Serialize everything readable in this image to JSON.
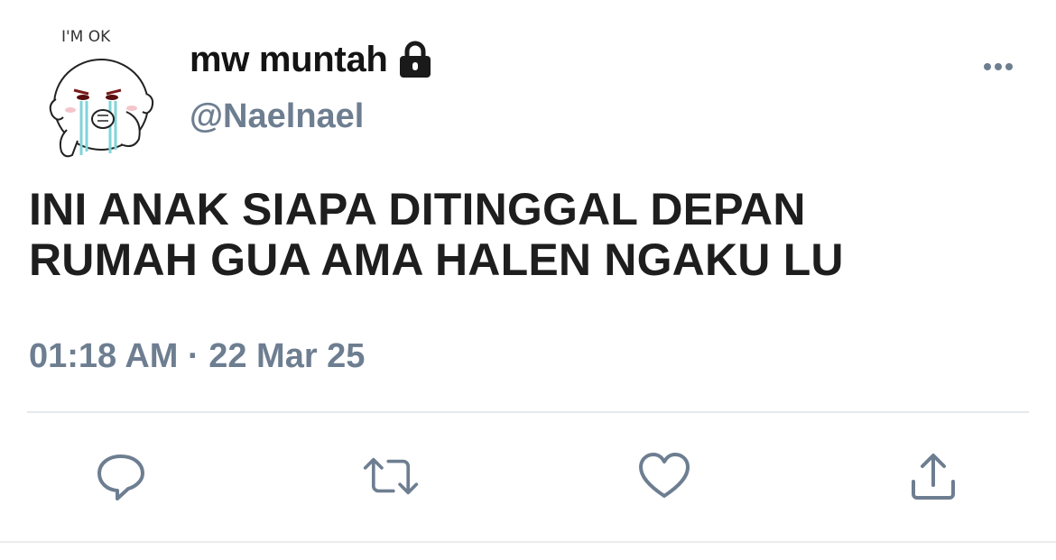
{
  "author": {
    "display_name": "mw muntah",
    "handle": "@Naelnael",
    "avatar_caption": "I'M OK",
    "protected": true
  },
  "tweet": {
    "text_lines": [
      "INI ANAK SIAPA DITINGGAL DEPAN",
      "RUMAH GUA AMA HALEN NGAKU LU"
    ],
    "time": "01:18 AM",
    "separator": "·",
    "date": "22 Mar 25"
  },
  "actions": [
    {
      "name": "reply",
      "icon": "comment-icon"
    },
    {
      "name": "retweet",
      "icon": "retweet-icon"
    },
    {
      "name": "like",
      "icon": "heart-icon"
    },
    {
      "name": "share",
      "icon": "share-icon"
    }
  ],
  "colors": {
    "text": "#1e1e1e",
    "secondary": "#6e7e91",
    "divider": "#e6e9ec"
  }
}
